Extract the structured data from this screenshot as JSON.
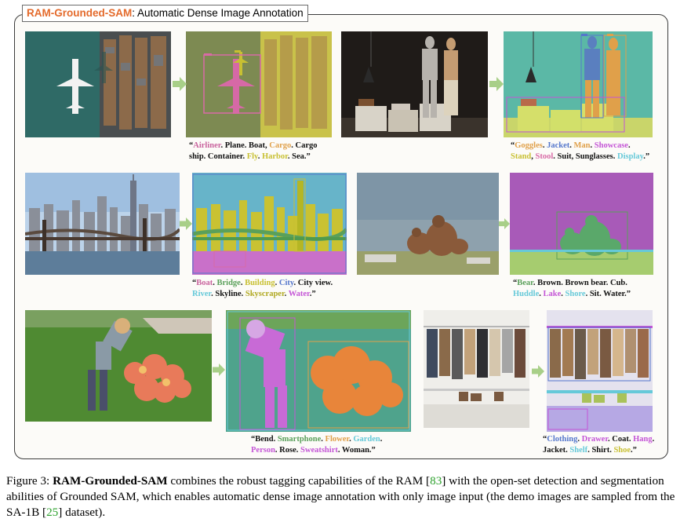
{
  "panel": {
    "title_brand": "RAM-Grounded-SAM",
    "title_rest": ": Automatic Dense Image Annotation"
  },
  "colors": {
    "arrow": "#a8cf88",
    "brand": "#e46a2b",
    "citation": "#2ca02c"
  },
  "examples": [
    {
      "id": "airport",
      "tags": [
        {
          "text": "Airliner",
          "color": "#c9649e"
        },
        {
          "text": ". Plane. Boat, ",
          "color": "#111111"
        },
        {
          "text": "Cargo",
          "color": "#e0a04a"
        },
        {
          "text": ". Cargo",
          "color": "#111111"
        }
      ],
      "tags_line2": [
        {
          "text": "ship. Container. ",
          "color": "#111111"
        },
        {
          "text": "Fly",
          "color": "#c8c032"
        },
        {
          "text": ". ",
          "color": "#111111"
        },
        {
          "text": "Harbor",
          "color": "#c8c032"
        },
        {
          "text": ". Sea.”",
          "color": "#111111"
        }
      ]
    },
    {
      "id": "showcase",
      "tags": [
        {
          "text": "Goggles",
          "color": "#e0a04a"
        },
        {
          "text": ". ",
          "color": "#111111"
        },
        {
          "text": "Jacket",
          "color": "#5577cc"
        },
        {
          "text": ". ",
          "color": "#111111"
        },
        {
          "text": "Man",
          "color": "#e0a04a"
        },
        {
          "text": ". ",
          "color": "#111111"
        },
        {
          "text": "Showcase",
          "color": "#c455d6"
        },
        {
          "text": ".",
          "color": "#111111"
        }
      ],
      "tags_line2": [
        {
          "text": "Stand",
          "color": "#c8c032"
        },
        {
          "text": ", ",
          "color": "#111111"
        },
        {
          "text": "Stool",
          "color": "#d86aa6"
        },
        {
          "text": ". Suit, Sunglasses. ",
          "color": "#111111"
        },
        {
          "text": "Display",
          "color": "#66c9d9"
        },
        {
          "text": ".”",
          "color": "#111111"
        }
      ]
    },
    {
      "id": "city",
      "tags": [
        {
          "text": "Boat",
          "color": "#c9649e"
        },
        {
          "text": ". ",
          "color": "#111111"
        },
        {
          "text": "Bridge",
          "color": "#5aa05a"
        },
        {
          "text": ". ",
          "color": "#111111"
        },
        {
          "text": "Building",
          "color": "#c8c032"
        },
        {
          "text": ". ",
          "color": "#111111"
        },
        {
          "text": "City",
          "color": "#5577cc"
        },
        {
          "text": ". City view.",
          "color": "#111111"
        }
      ],
      "tags_line2": [
        {
          "text": "River",
          "color": "#66c9d9"
        },
        {
          "text": ". Skyline. ",
          "color": "#111111"
        },
        {
          "text": "Skyscraper",
          "color": "#b0a820"
        },
        {
          "text": ". ",
          "color": "#111111"
        },
        {
          "text": "Water",
          "color": "#c455d6"
        },
        {
          "text": ".”",
          "color": "#111111"
        }
      ]
    },
    {
      "id": "bear",
      "tags": [
        {
          "text": "Bear",
          "color": "#5aa05a"
        },
        {
          "text": ". Brown. Brown bear. Cub.",
          "color": "#111111"
        }
      ],
      "tags_line2": [
        {
          "text": "Huddle",
          "color": "#66c9d9"
        },
        {
          "text": ". ",
          "color": "#111111"
        },
        {
          "text": "Lake",
          "color": "#c455d6"
        },
        {
          "text": ". ",
          "color": "#111111"
        },
        {
          "text": "Shore",
          "color": "#66c9d9"
        },
        {
          "text": ". Sit. Water.”",
          "color": "#111111"
        }
      ]
    },
    {
      "id": "garden",
      "tags": [
        {
          "text": "Bend",
          "color": "#111111"
        },
        {
          "text": ". ",
          "color": "#111111"
        },
        {
          "text": "Smartphone",
          "color": "#5aa05a"
        },
        {
          "text": ". ",
          "color": "#111111"
        },
        {
          "text": "Flower",
          "color": "#e0a04a"
        },
        {
          "text": ". ",
          "color": "#111111"
        },
        {
          "text": "Garden",
          "color": "#66c9d9"
        },
        {
          "text": ".",
          "color": "#111111"
        }
      ],
      "tags_line2": [
        {
          "text": "Person",
          "color": "#c455d6"
        },
        {
          "text": ". Rose. ",
          "color": "#111111"
        },
        {
          "text": "Sweatshirt",
          "color": "#c455d6"
        },
        {
          "text": ". Woman.”",
          "color": "#111111"
        }
      ]
    },
    {
      "id": "clothing",
      "tags": [
        {
          "text": "Clothing",
          "color": "#5577cc"
        },
        {
          "text": ". ",
          "color": "#111111"
        },
        {
          "text": "Drawer",
          "color": "#c455d6"
        },
        {
          "text": ". Coat. ",
          "color": "#111111"
        },
        {
          "text": "Hang",
          "color": "#c455d6"
        },
        {
          "text": ".",
          "color": "#111111"
        }
      ],
      "tags_line2": [
        {
          "text": "Jacket. ",
          "color": "#111111"
        },
        {
          "text": "Shelf",
          "color": "#66c9d9"
        },
        {
          "text": ". Shirt. ",
          "color": "#111111"
        },
        {
          "text": "Shoe",
          "color": "#c8c032"
        },
        {
          "text": ".”",
          "color": "#111111"
        }
      ]
    }
  ],
  "figure_caption": {
    "label": "Figure 3: ",
    "name": "RAM-Grounded-SAM",
    "part1": " combines the robust tagging capabilities of the RAM [",
    "cite1": "83",
    "part2": "] with the open-set detection and segmentation abilities of Grounded SAM, which enables automatic dense image annotation with only image input (the demo images are sampled from the SA-1B [",
    "cite2": "25",
    "part3": "] dataset)."
  }
}
